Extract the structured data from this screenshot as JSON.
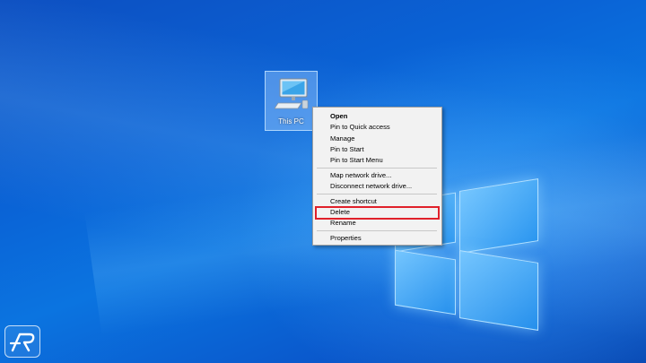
{
  "desktop": {
    "icons": [
      {
        "label": "This PC",
        "icon": "computer-icon",
        "selected": true
      }
    ]
  },
  "context_menu": {
    "items": [
      {
        "label": "Open",
        "bold": true
      },
      {
        "label": "Pin to Quick access"
      },
      {
        "label": "Manage"
      },
      {
        "label": "Pin to Start"
      },
      {
        "label": "Pin to Start Menu"
      },
      {
        "label": "Map network drive..."
      },
      {
        "label": "Disconnect network drive..."
      },
      {
        "label": "Create shortcut"
      },
      {
        "label": "Delete",
        "highlighted": true
      },
      {
        "label": "Rename"
      },
      {
        "label": "Properties"
      }
    ]
  },
  "colors": {
    "highlight_border": "#e0202a",
    "menu_background": "#f2f2f2"
  }
}
